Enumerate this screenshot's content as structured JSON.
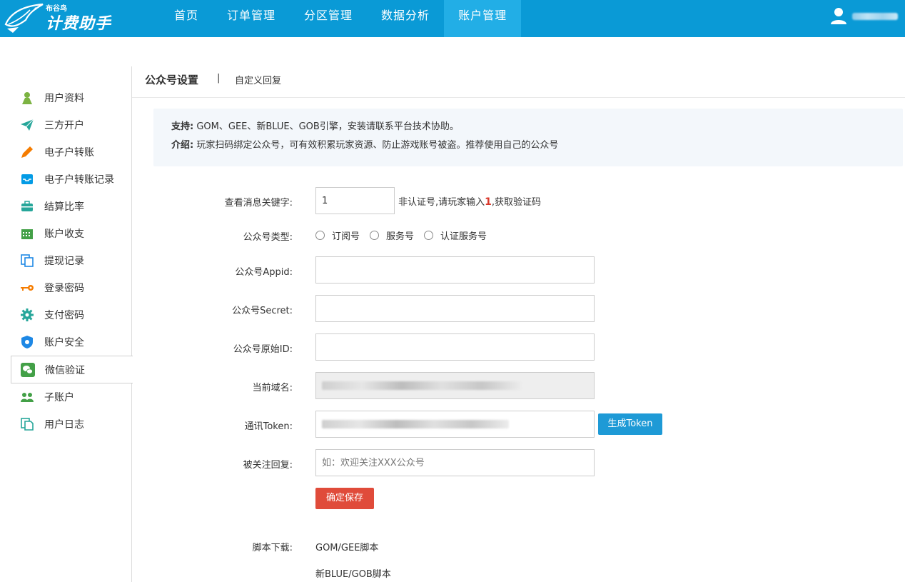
{
  "header": {
    "logo_small": "布谷鸟",
    "logo_big": "计费助手",
    "nav": [
      "首页",
      "订单管理",
      "分区管理",
      "数据分析",
      "账户管理"
    ],
    "active_nav": 4
  },
  "sidebar": {
    "items": [
      {
        "label": "用户资料",
        "icon": "user-icon",
        "color": "#7cb342"
      },
      {
        "label": "三方开户",
        "icon": "paper-plane-icon",
        "color": "#26a69a"
      },
      {
        "label": "电子户转账",
        "icon": "pencil-icon",
        "color": "#f57c00"
      },
      {
        "label": "电子户转账记录",
        "icon": "inbox-icon",
        "color": "#039be5"
      },
      {
        "label": "结算比率",
        "icon": "briefcase-icon",
        "color": "#26a69a"
      },
      {
        "label": "账户收支",
        "icon": "calendar-icon",
        "color": "#43a047"
      },
      {
        "label": "提现记录",
        "icon": "copy-icon",
        "color": "#1e88e5"
      },
      {
        "label": "登录密码",
        "icon": "key-icon",
        "color": "#f57c00"
      },
      {
        "label": "支付密码",
        "icon": "gear-icon",
        "color": "#26a69a"
      },
      {
        "label": "账户安全",
        "icon": "shield-icon",
        "color": "#1e88e5"
      },
      {
        "label": "微信验证",
        "icon": "wechat-icon",
        "color": "#43a047"
      },
      {
        "label": "子账户",
        "icon": "users-icon",
        "color": "#43a047"
      },
      {
        "label": "用户日志",
        "icon": "document-icon",
        "color": "#26a69a"
      }
    ],
    "active_index": 10
  },
  "tabs": {
    "title": "公众号设置",
    "separator": "|",
    "link": "自定义回复"
  },
  "notice": {
    "support_label": "支持:",
    "support_text": "GOM、GEE、新BLUE、GOB引擎，安装请联系平台技术协助。",
    "intro_label": "介绍:",
    "intro_text": "玩家扫码绑定公众号，可有效积累玩家资源、防止游戏账号被盗。推荐使用自己的公众号"
  },
  "form": {
    "keyword_label": "查看消息关键字:",
    "keyword_value": "1",
    "keyword_hint_pre": "非认证号,请玩家输入",
    "keyword_hint_num": "1",
    "keyword_hint_post": ",获取验证码",
    "type_label": "公众号类型:",
    "type_options": [
      "订阅号",
      "服务号",
      "认证服务号"
    ],
    "appid_label": "公众号Appid:",
    "secret_label": "公众号Secret:",
    "origin_label": "公众号原始ID:",
    "domain_label": "当前域名:",
    "token_label": "通讯Token:",
    "token_button": "生成Token",
    "reply_label": "被关注回复:",
    "reply_placeholder": "如：欢迎关注XXX公众号",
    "save_button": "确定保存",
    "download_label": "脚本下载:",
    "download_links": [
      "GOM/GEE脚本",
      "新BLUE/GOB脚本"
    ]
  },
  "colors": {
    "header_bg": "#0a9ad6",
    "active_nav_bg": "#22aee6",
    "token_button": "#1e9ad6",
    "save_button": "#e04b3a",
    "hint_number": "#d9372a"
  }
}
